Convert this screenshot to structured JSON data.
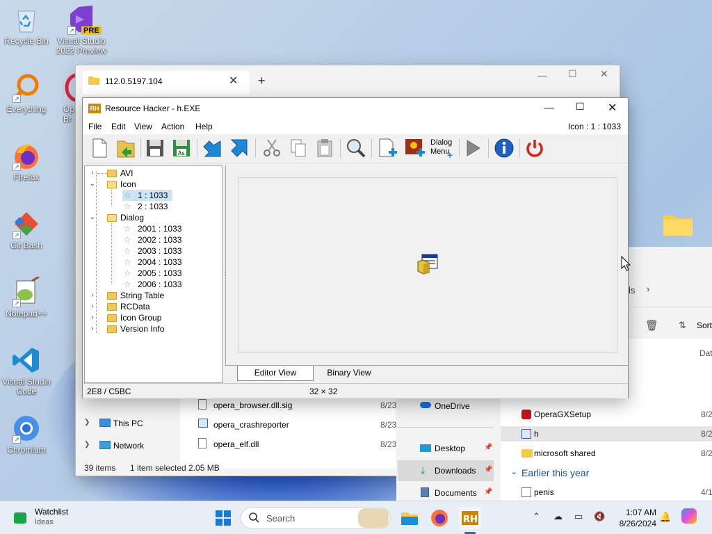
{
  "desktop": {
    "icons": [
      {
        "label": "Recycle Bin"
      },
      {
        "label": "Visual Studio 2022 Preview",
        "badge": "PRE"
      },
      {
        "label": "Everything"
      },
      {
        "label": "Op Br"
      },
      {
        "label": "Firefox"
      },
      {
        "label": "Git Bash"
      },
      {
        "label": "Notepad++"
      },
      {
        "label": "Visual Studio Code"
      },
      {
        "label": "Chromium"
      }
    ]
  },
  "explorer": {
    "tab_title": "112.0.5197.104",
    "tab_close": "✕",
    "new_tab": "+",
    "nav": [
      {
        "label": "This PC",
        "icon": "pc-icon"
      },
      {
        "label": "Network",
        "icon": "network-icon"
      }
    ],
    "files": [
      {
        "name": "opera_browser.dll.sig",
        "date": "8/23"
      },
      {
        "name": "opera_crashreporter",
        "date": "8/23"
      },
      {
        "name": "opera_elf.dll",
        "date": "8/23"
      }
    ],
    "status": {
      "count": "39 items",
      "selection": "1 item selected  2.05 MB"
    }
  },
  "explorer2": {
    "breadcrumb_tail": "ls",
    "toolbar_sort": "Sort",
    "col_date": "Dat",
    "nav": [
      {
        "label": "OneDrive",
        "icon": "onedrive-icon"
      },
      {
        "label": "Desktop",
        "icon": "desktop-icon",
        "pinned": true
      },
      {
        "label": "Downloads",
        "icon": "download-icon",
        "pinned": true
      },
      {
        "label": "Documents",
        "icon": "documents-icon",
        "pinned": true
      }
    ],
    "files": [
      {
        "name": "OperaGXSetup",
        "date": "8/2"
      },
      {
        "name": "h",
        "date": "8/2"
      },
      {
        "name": "microsoft shared",
        "date": "8/2"
      }
    ],
    "group_header": "Earlier this year",
    "files_earlier": [
      {
        "name": "penis",
        "date": "4/1"
      }
    ]
  },
  "rh": {
    "title": "Resource Hacker - h.EXE",
    "logo": "RH",
    "menu": [
      "File",
      "Edit",
      "View",
      "Action",
      "Help"
    ],
    "icon_info": "Icon : 1 : 1033",
    "toolbar_dialog_label_1": "Dialog",
    "toolbar_dialog_label_2": "Menu",
    "tree": {
      "avi": "AVI",
      "icon": "Icon",
      "icon_children": [
        "1 : 1033",
        "2 : 1033"
      ],
      "dialog": "Dialog",
      "dialog_children": [
        "2001 : 1033",
        "2002 : 1033",
        "2003 : 1033",
        "2004 : 1033",
        "2005 : 1033",
        "2006 : 1033"
      ],
      "string_table": "String Table",
      "rcdata": "RCData",
      "icon_group": "Icon Group",
      "version_info": "Version Info"
    },
    "tabs": {
      "editor": "Editor View",
      "binary": "Binary View"
    },
    "status": {
      "offset": "2E8 / C5BC",
      "size": "32 × 32"
    }
  },
  "taskbar": {
    "weather_title": "Watchlist",
    "weather_sub": "Ideas",
    "search_placeholder": "Search",
    "time": "1:07 AM",
    "date": "8/26/2024"
  }
}
